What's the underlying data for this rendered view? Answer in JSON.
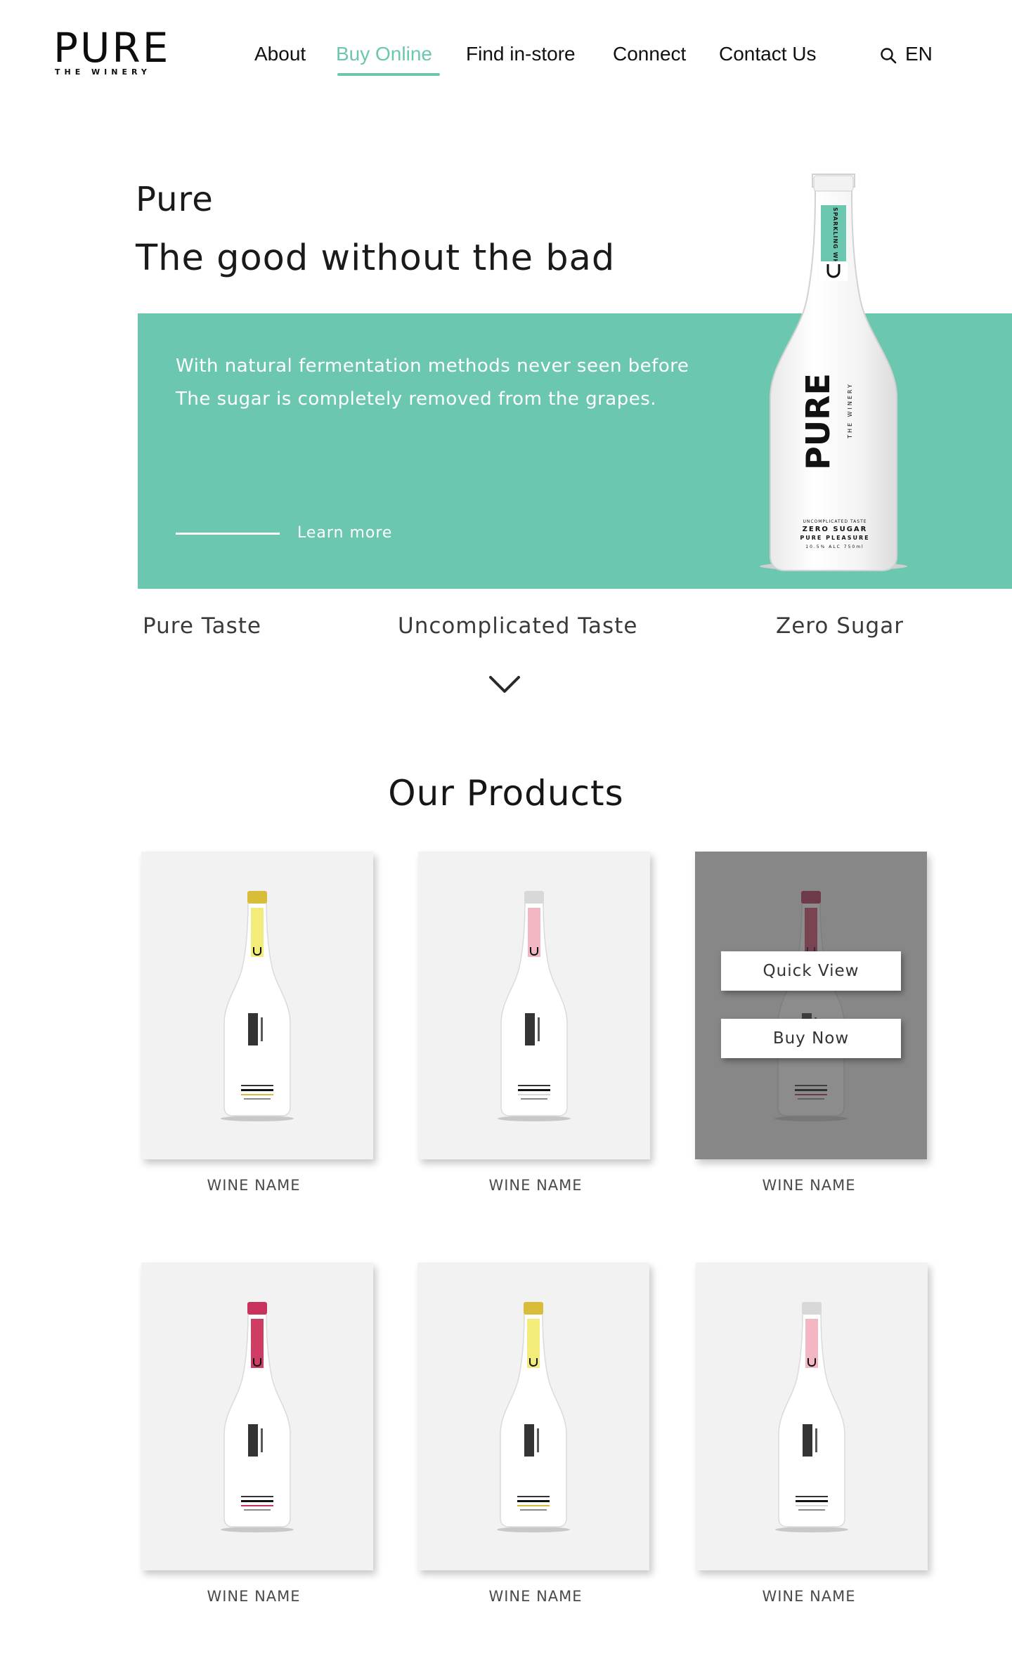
{
  "header": {
    "logo": {
      "word": "PURE",
      "sub": "THE WINERY"
    },
    "nav": [
      "About",
      "Buy Online",
      "Find in-store",
      "Connect",
      "Contact Us"
    ],
    "active_nav": "Buy Online",
    "language": "EN"
  },
  "hero": {
    "eyebrow": "Pure",
    "title": "The good without the bad",
    "line1": "With natural fermentation methods never seen before",
    "line2": "The sugar is completely removed from the grapes.",
    "cta": "Learn more",
    "bottle_label": {
      "top": "SPARKLING WHITE",
      "brand": "PURE",
      "brand_sub": "THE WINERY",
      "claims": [
        "UNCOMPLICATED TASTE",
        "ZERO SUGAR",
        "PURE PLEASURE",
        "10.5% ALC 750ml"
      ]
    }
  },
  "features": [
    "Pure Taste",
    "Uncomplicated Taste",
    "Zero Sugar"
  ],
  "products": {
    "title": "Our Products",
    "quick_view": "Quick View",
    "buy_now": "Buy Now",
    "items": [
      {
        "name": "WINE NAME",
        "cap_color": "#d9bd3a",
        "label_color": "#f3ec7a"
      },
      {
        "name": "WINE NAME",
        "cap_color": "#d8d8d8",
        "label_color": "#f2b7c2"
      },
      {
        "name": "WINE NAME",
        "cap_color": "#b0294f",
        "label_color": "#cc3f66"
      },
      {
        "name": "WINE NAME",
        "cap_color": "#c9325c",
        "label_color": "#cf3d64"
      },
      {
        "name": "WINE NAME",
        "cap_color": "#d9bd3a",
        "label_color": "#f3ec7a"
      },
      {
        "name": "WINE NAME",
        "cap_color": "#d8d8d8",
        "label_color": "#f2b7c2"
      }
    ]
  },
  "colors": {
    "accent": "#6cc7b0",
    "text": "#111111"
  }
}
